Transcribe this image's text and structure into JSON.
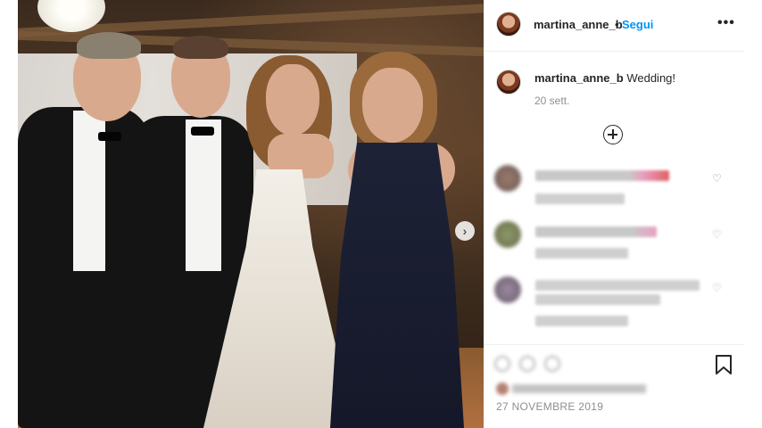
{
  "post": {
    "username": "martina_anne_b",
    "follow_label": "Segui",
    "separator": "•",
    "more_label": "•••",
    "caption_text": "Wedding!",
    "caption_time": "20 sett.",
    "next_label": "›",
    "date": "27 NOVEMBRE 2019"
  },
  "colors": {
    "follow_blue": "#0095f6",
    "muted": "#8e8e8e"
  },
  "icons": {
    "load_more": "plus-circle-icon",
    "next": "chevron-right-icon",
    "bookmark": "bookmark-icon",
    "like": "heart-icon"
  }
}
